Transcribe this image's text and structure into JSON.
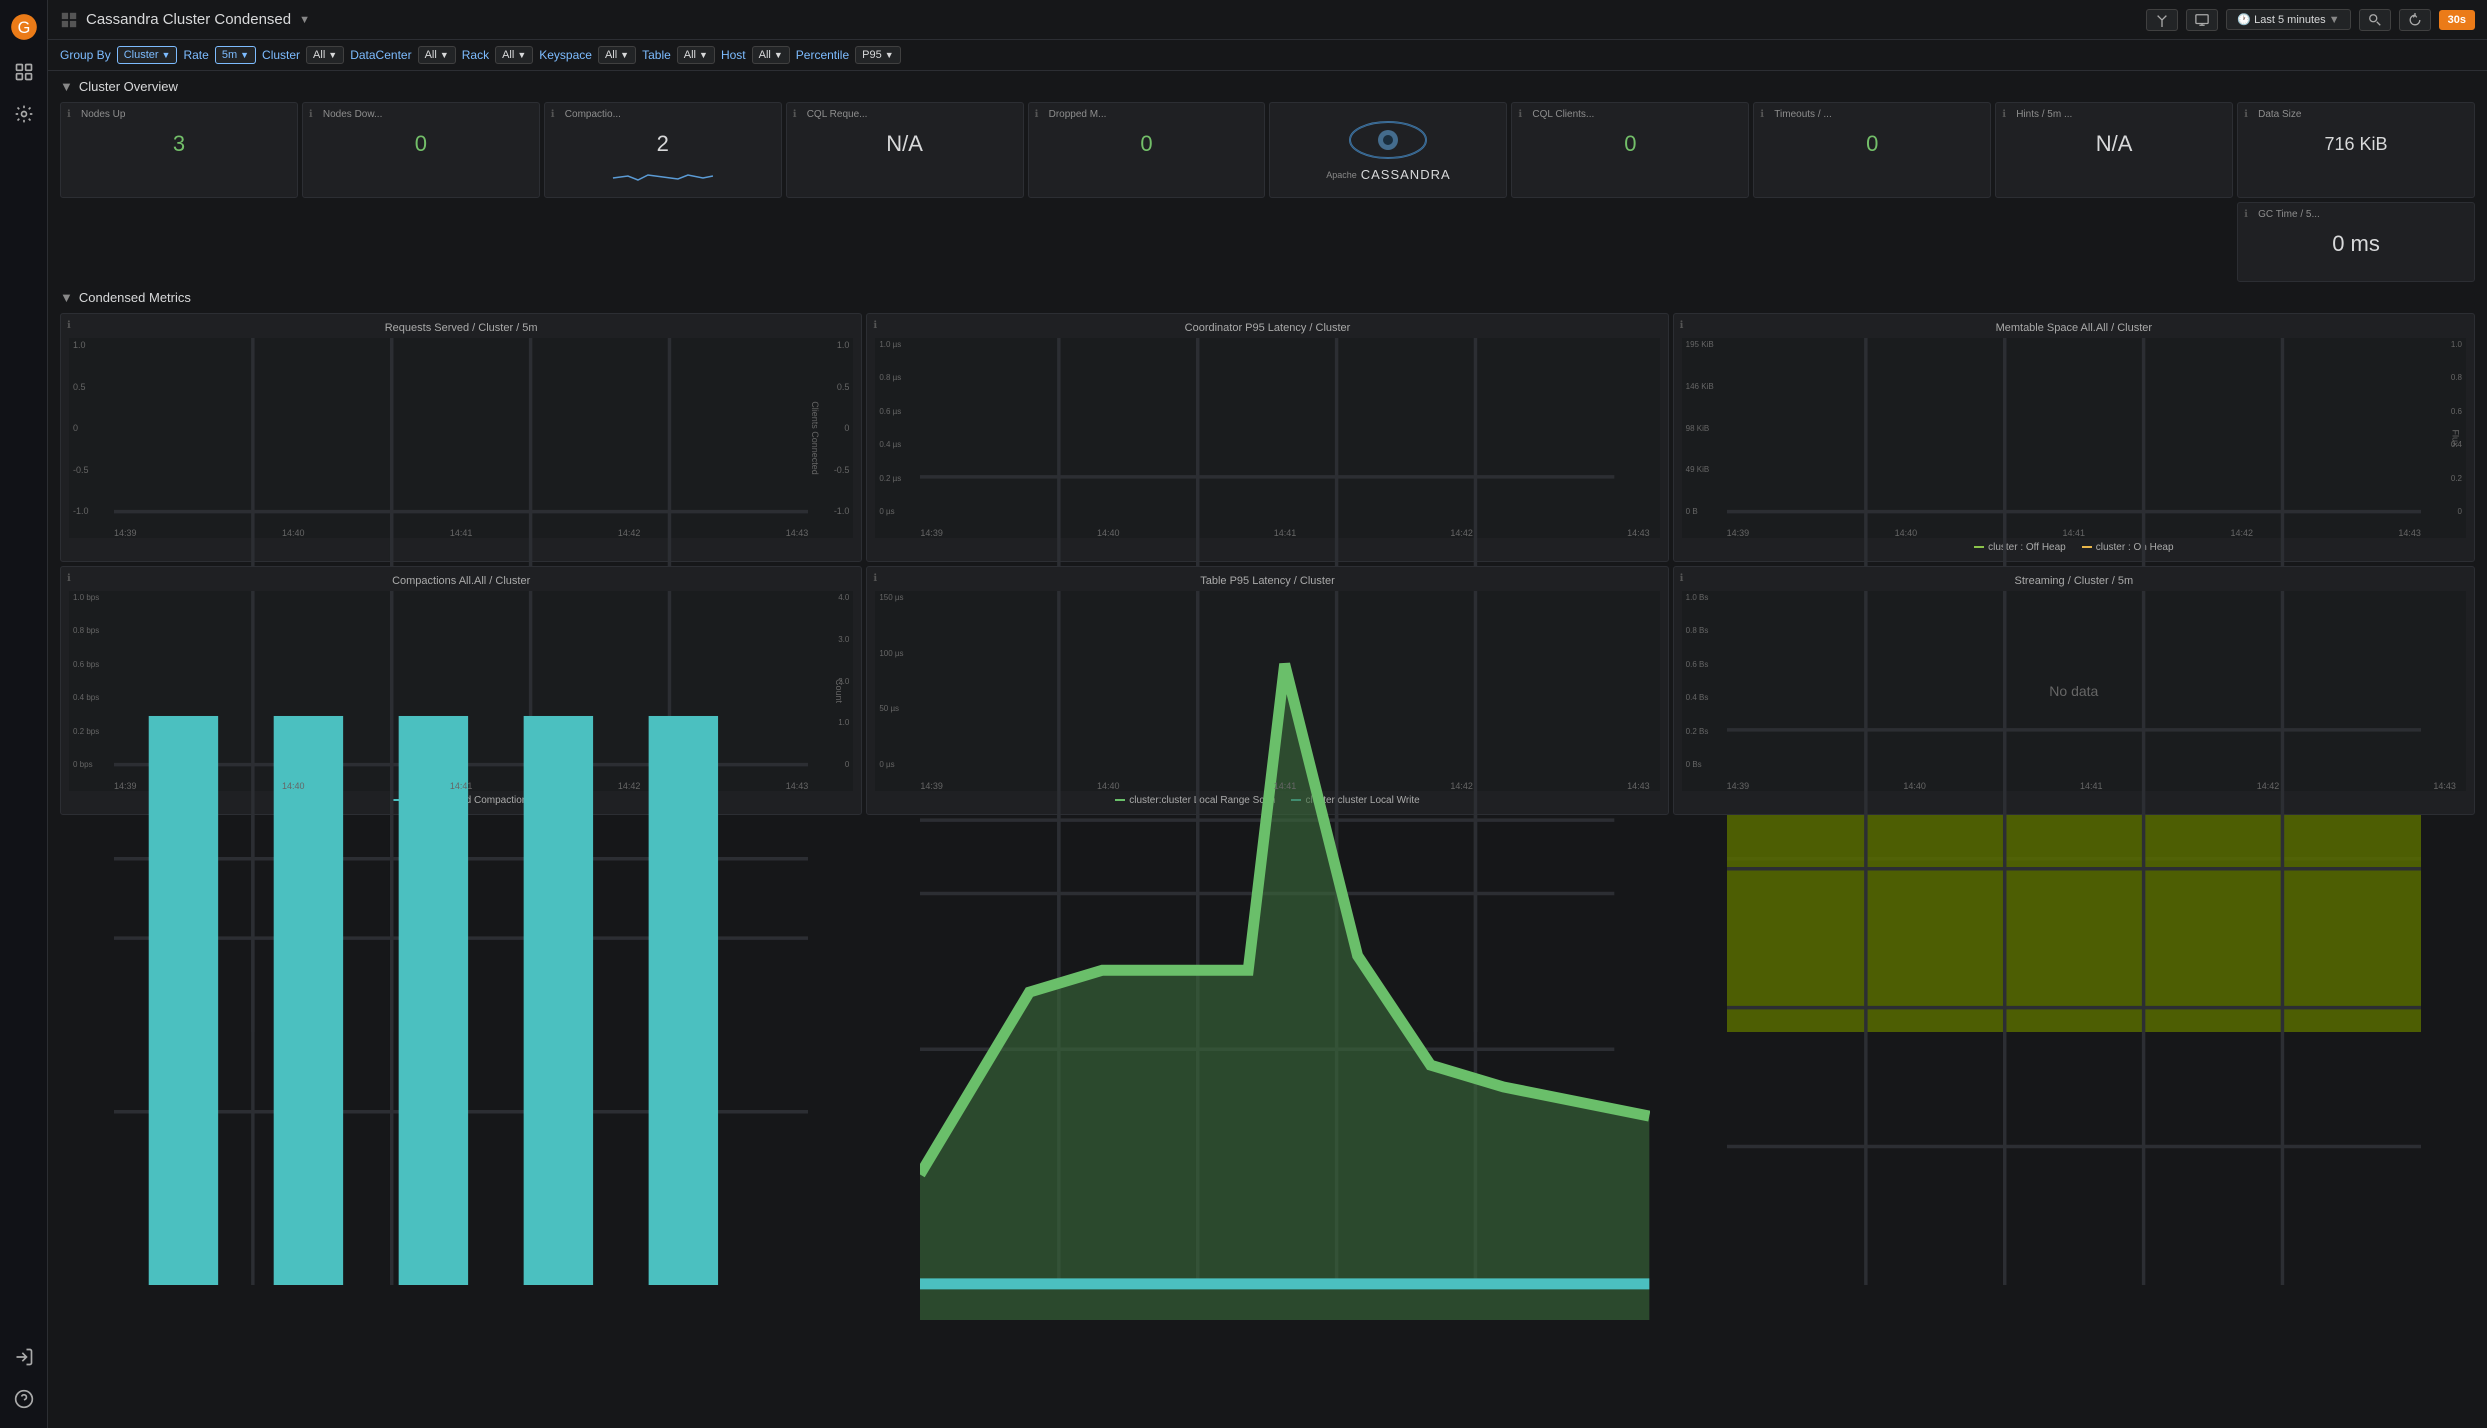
{
  "app": {
    "logo": "grafana",
    "title": "Cassandra Cluster Condensed",
    "title_arrow": "▼"
  },
  "topbar": {
    "share_label": "⬆",
    "tv_label": "⬜",
    "time_range": "Last 5 minutes",
    "search_label": "🔍",
    "refresh_label": "↻",
    "refresh_interval": "30s"
  },
  "toolbar": {
    "group_by_label": "Group By",
    "group_by_value": "Cluster",
    "rate_label": "Rate",
    "rate_value": "5m",
    "cluster_label": "Cluster",
    "cluster_value": "All",
    "datacenter_label": "DataCenter",
    "datacenter_value": "All",
    "rack_label": "Rack",
    "rack_value": "All",
    "keyspace_label": "Keyspace",
    "keyspace_value": "All",
    "table_label": "Table",
    "table_value": "All",
    "host_label": "Host",
    "host_value": "All",
    "percentile_label": "Percentile",
    "percentile_value": "P95"
  },
  "cluster_overview": {
    "title": "Cluster Overview",
    "cards": [
      {
        "id": "nodes-up",
        "title": "Nodes Up",
        "value": "3",
        "type": "green"
      },
      {
        "id": "nodes-down",
        "title": "Nodes Dow...",
        "value": "0",
        "type": "green"
      },
      {
        "id": "compactions",
        "title": "Compactio...",
        "value": "2",
        "type": "sparkline"
      },
      {
        "id": "cql-requests",
        "title": "CQL Reque...",
        "value": "N/A",
        "type": "white"
      },
      {
        "id": "dropped-msg",
        "title": "Dropped M...",
        "value": "0",
        "type": "green"
      },
      {
        "id": "cql-clients",
        "title": "CQL Clients...",
        "value": "0",
        "type": "green"
      },
      {
        "id": "timeouts",
        "title": "Timeouts / ...",
        "value": "0",
        "type": "green"
      },
      {
        "id": "hints",
        "title": "Hints / 5m ...",
        "value": "N/A",
        "type": "white"
      },
      {
        "id": "data-size",
        "title": "Data Size",
        "value": "716 KiB",
        "type": "white"
      },
      {
        "id": "gc-time",
        "title": "GC Time / 5...",
        "value": "0 ms",
        "type": "white"
      }
    ]
  },
  "condensed_metrics": {
    "title": "Condensed Metrics",
    "charts": [
      {
        "id": "requests-served",
        "title": "Requests Served / Cluster / 5m",
        "has_right_axis": true,
        "right_axis_label": "Clients Connected",
        "y_labels": [
          "1.0",
          "0.5",
          "0",
          "-0.5",
          "-1.0"
        ],
        "y_labels_right": [
          "1.0",
          "0.5",
          "0",
          "-0.5",
          "-1.0"
        ],
        "x_labels": [
          "14:39",
          "14:40",
          "14:41",
          "14:42",
          "14:43"
        ]
      },
      {
        "id": "coordinator-latency",
        "title": "Coordinator P95 Latency / Cluster",
        "has_right_axis": false,
        "y_labels": [
          "1.0 µs",
          "0.8 µs",
          "0.6 µs",
          "0.4 µs",
          "0.2 µs",
          "0 µs"
        ],
        "x_labels": [
          "14:39",
          "14:40",
          "14:41",
          "14:42",
          "14:43"
        ]
      },
      {
        "id": "memtable-space",
        "title": "Memtable Space All.All / Cluster",
        "has_right_axis": true,
        "right_axis_label": "Flux",
        "y_labels": [
          "195 KiB",
          "146 KiB",
          "98 KiB",
          "49 KiB",
          "0 B"
        ],
        "y_labels_right": [
          "1.0",
          "0.8",
          "0.6",
          "0.4",
          "0.2",
          "0"
        ],
        "x_labels": [
          "14:39",
          "14:40",
          "14:41",
          "14:42",
          "14:43"
        ],
        "legend": [
          {
            "color": "#8bc34a",
            "label": "cluster : Off Heap"
          },
          {
            "color": "#e8b64a",
            "label": "cluster : On Heap"
          }
        ]
      },
      {
        "id": "compactions-all",
        "title": "Compactions All.All / Cluster",
        "has_right_axis": true,
        "right_axis_label": "Count",
        "y_labels": [
          "1.0 bps",
          "0.8 bps",
          "0.6 bps",
          "0.4 bps",
          "0.2 bps",
          "0 bps"
        ],
        "y_labels_right": [
          "4.0",
          "3.0",
          "2.0",
          "1.0",
          "0"
        ],
        "x_labels": [
          "14:39",
          "14:40",
          "14:41",
          "14:42",
          "14:43"
        ],
        "legend": [
          {
            "color": "#4bc0c0",
            "label": "by : Completed Compactions"
          }
        ]
      },
      {
        "id": "table-latency",
        "title": "Table P95 Latency / Cluster",
        "has_right_axis": false,
        "y_labels": [
          "150 µs",
          "100 µs",
          "50 µs",
          "0 µs"
        ],
        "x_labels": [
          "14:39",
          "14:40",
          "14:41",
          "14:42",
          "14:43"
        ],
        "legend": [
          {
            "color": "#6abf6a",
            "label": "cluster:cluster Local Range Scan"
          },
          {
            "color": "#4bc0c0",
            "label": "cluster:cluster Local Write"
          }
        ]
      },
      {
        "id": "streaming",
        "title": "Streaming / Cluster / 5m",
        "no_data": true,
        "y_labels": [
          "1.0 Bs",
          "0.8 Bs",
          "0.6 Bs",
          "0.4 Bs",
          "0.2 Bs",
          "0 Bs"
        ],
        "x_labels": [
          "14:39",
          "14:40",
          "14:41",
          "14:42",
          "14:43"
        ],
        "no_data_label": "No data"
      }
    ]
  }
}
